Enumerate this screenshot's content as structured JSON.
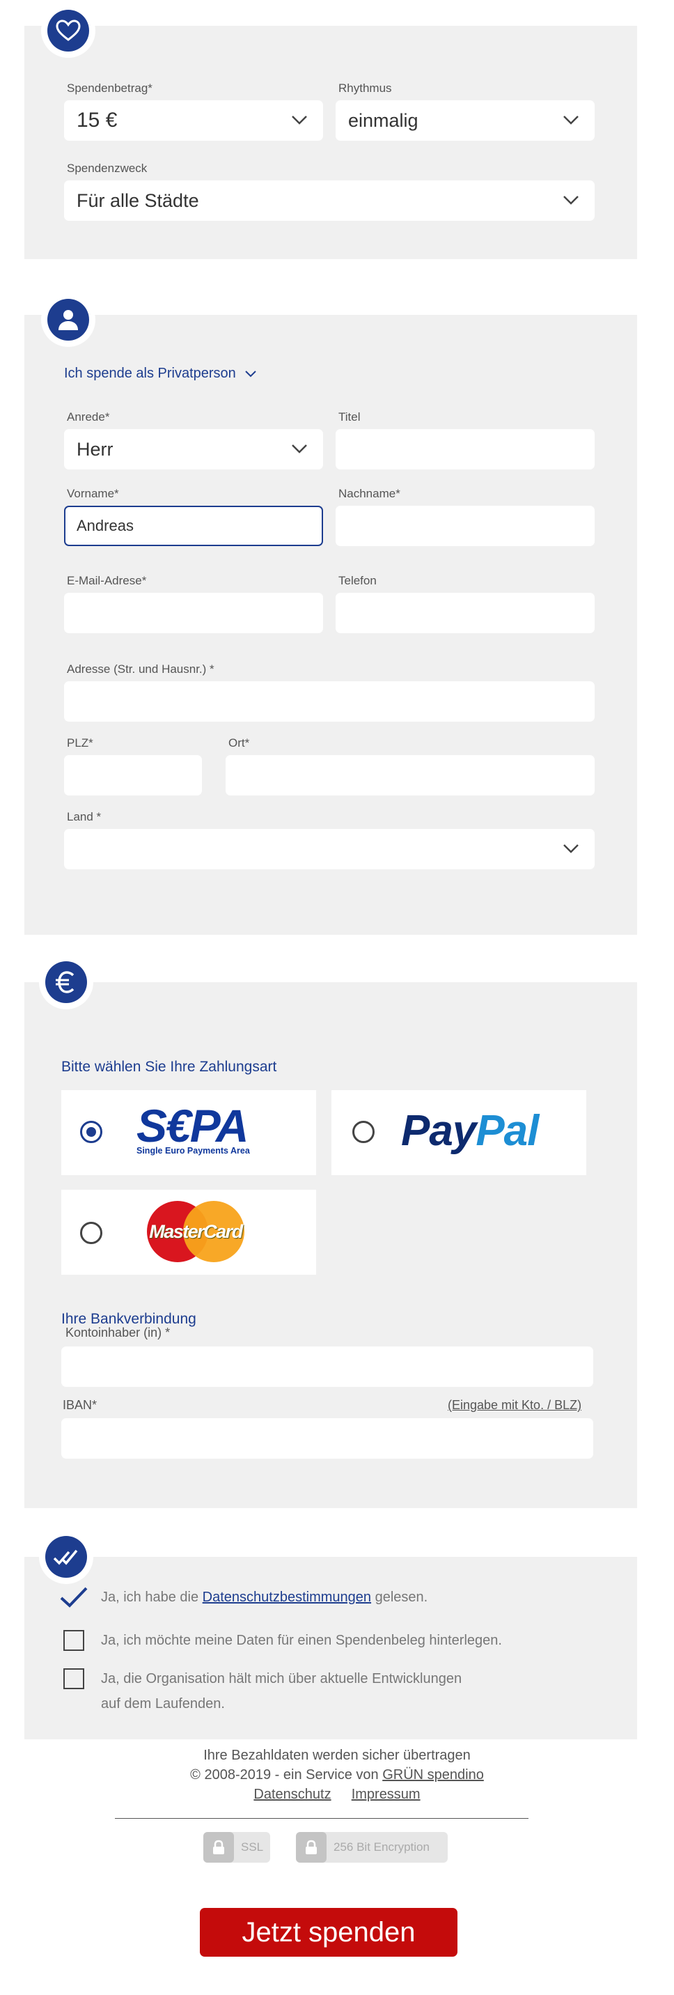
{
  "amount_section": {
    "amount_label": "Spendenbetrag*",
    "amount_value": "15 €",
    "rhythm_label": "Rhythmus",
    "rhythm_value": "einmalig",
    "purpose_label": "Spendenzweck",
    "purpose_value": "Für alle Städte"
  },
  "person_section": {
    "type_toggle": "Ich spende als Privatperson",
    "salutation_label": "Anrede*",
    "salutation_value": "Herr",
    "title_label": "Titel",
    "title_value": "",
    "firstname_label": "Vorname*",
    "firstname_value": "Andreas",
    "lastname_label": "Nachname*",
    "lastname_value": "",
    "email_label": "E-Mail-Adrese*",
    "email_value": "",
    "phone_label": "Telefon",
    "phone_value": "",
    "address_label": "Adresse (Str. und Hausnr.) *",
    "address_value": "",
    "zip_label": "PLZ*",
    "zip_value": "",
    "city_label": "Ort*",
    "city_value": "",
    "country_label": "Land *",
    "country_value": ""
  },
  "payment_section": {
    "heading": "Bitte wählen Sie Ihre Zahlungsart",
    "methods": [
      {
        "name": "SEPA",
        "logo_main": "S€PA",
        "logo_sub": "Single Euro Payments Area",
        "selected": true
      },
      {
        "name": "PayPal",
        "logo_main_a": "Pay",
        "logo_main_b": "Pal",
        "selected": false
      },
      {
        "name": "MasterCard",
        "logo_main": "MasterCard",
        "selected": false
      }
    ],
    "bank_heading": "Ihre Bankverbindung",
    "holder_label": "Kontoinhaber (in) *",
    "holder_value": "",
    "iban_label": "IBAN*",
    "iban_alt_link": "(Eingabe mit Kto. / BLZ)",
    "iban_value": ""
  },
  "consent_section": {
    "privacy_pre": "Ja, ich habe die",
    "privacy_link": "Datenschutzbestimmungen",
    "privacy_post": "gelesen.",
    "receipt_text": "Ja, ich möchte meine Daten für einen Spendenbeleg hinterlegen.",
    "updates_line1": "Ja, die Organisation hält mich über aktuelle Entwicklungen",
    "updates_line2": "auf dem Laufenden."
  },
  "footer": {
    "secure_note": "Ihre Bezahldaten werden sicher übertragen",
    "copyright_pre": "© 2008-2019 - ein Service von",
    "copyright_link": "GRÜN spendino",
    "privacy_link": "Datenschutz",
    "imprint_link": "Impressum",
    "ssl_badge": "SSL",
    "encryption_badge": "256 Bit Encryption"
  },
  "submit_button": "Jetzt spenden",
  "colors": {
    "primary_blue": "#1d3d8f",
    "donate_red": "#c40b0b",
    "section_bg": "#f0f0f0"
  },
  "icons": [
    "heart-icon",
    "user-icon",
    "euro-icon",
    "double-check-icon",
    "chevron-down-icon",
    "checkmark-icon",
    "lock-icon"
  ]
}
